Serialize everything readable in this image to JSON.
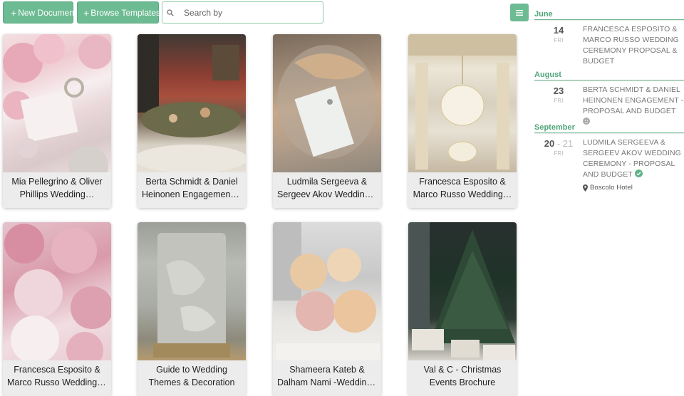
{
  "toolbar": {
    "new_document": "New Document",
    "browse_templates": "Browse Templates",
    "search_placeholder": "Search by",
    "plus_glyph": "+"
  },
  "cards": [
    {
      "line1": "Mia Pellegrino & Oliver",
      "line2": "Phillips Wedding…",
      "image": "pink peonies, rings and card"
    },
    {
      "line1": "Berta Schmidt & Daniel",
      "line2": "Heinonen Engagement -…",
      "image": "banquet table setting"
    },
    {
      "line1": "Ludmila Sergeeva &",
      "line2": "Sergeev Akov Wedding…",
      "image": "place card on napkin"
    },
    {
      "line1": "Francesca Esposito &",
      "line2": "Marco Russo Wedding…",
      "image": "chandelier ballroom"
    },
    {
      "line1": "Francesca Esposito &",
      "line2": "Marco Russo Wedding-…",
      "image": "pink peonies"
    },
    {
      "line1": "Guide to Wedding",
      "line2": "Themes & Decoration",
      "image": "grey textured cake"
    },
    {
      "line1": "Shameera Kateb &",
      "line2": "Dalham Nami -Wedding…",
      "image": "cake with sugar roses"
    },
    {
      "line1": "Val & C - Christmas",
      "line2": "Events Brochure",
      "image": "christmas tree and gifts"
    }
  ],
  "calendar": [
    {
      "month": "June",
      "events": [
        {
          "day": "14",
          "range": "",
          "dow": "FRI",
          "title": "FRANCESCA ESPOSITO & MARCO RUSSO WEDDING CEREMONY PROPOSAL & BUDGET",
          "status": "",
          "location": ""
        }
      ]
    },
    {
      "month": "August",
      "events": [
        {
          "day": "23",
          "range": "",
          "dow": "FRI",
          "title": "BERTA SCHMIDT & DANIEL HEINONEN ENGAGEMENT - PROPOSAL AND BUDGET",
          "status": "neutral-face-icon",
          "location": ""
        }
      ]
    },
    {
      "month": "September",
      "events": [
        {
          "day": "20",
          "range": "- 21",
          "dow": "FRI",
          "title": "LUDMILA SERGEEVA & SERGEEV AKOV WEDDING CEREMONY - PROPOSAL AND BUDGET",
          "status": "check-circle-icon",
          "location": "Boscolo Hotel"
        }
      ]
    }
  ],
  "colors": {
    "accent": "#6dbb92",
    "month_text": "#4fa47a"
  }
}
